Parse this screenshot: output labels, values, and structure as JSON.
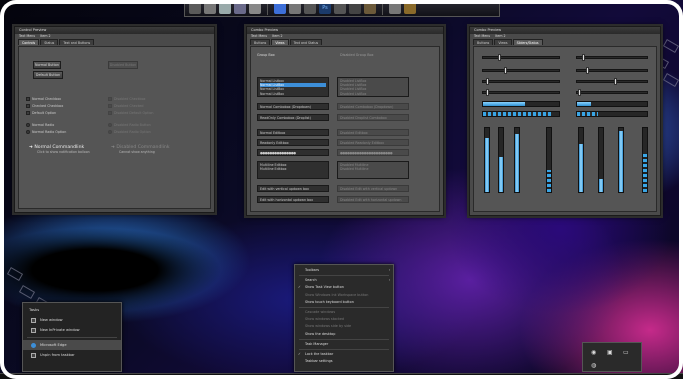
{
  "dock": {
    "icons": [
      "app-icon-1",
      "app-icon-2",
      "app-icon-3",
      "app-icon-4",
      "app-icon-5",
      "globe-icon",
      "app-icon-6",
      "app-icon-7",
      "photoshop-icon",
      "app-icon-8",
      "app-icon-9",
      "app-icon-10",
      "app-icon-11",
      "game-icon"
    ],
    "labels": {
      "ps": "Ps"
    }
  },
  "window1": {
    "title": "Control Preview",
    "menu": [
      "Text Menu",
      "Item 2"
    ],
    "tabs": [
      "Controls",
      "Status",
      "Text and Buttons"
    ],
    "normal_button": "Normal Button",
    "default_button": "Default Button",
    "disabled_button": "Disabled Button",
    "checkboxes_left": [
      "Normal Checkbox",
      "Checked Checkbox",
      "Default Option"
    ],
    "checkboxes_right": [
      "Disabled Checkbox",
      "Disabled Checked",
      "Disabled Default Option"
    ],
    "radios_left": [
      "Normal Radio",
      "Normal Radio Option"
    ],
    "radios_right": [
      "Disabled Radio Button",
      "Disabled Radio Option"
    ],
    "cmdlink_title": "Normal Commandlink",
    "cmdlink_sub": "Click to show notification balloon",
    "cmdlink_disabled_title": "Disabled Commandlink",
    "cmdlink_disabled_sub": "Cannot show anything"
  },
  "window2": {
    "title": "Combo Preview",
    "menu": [
      "Text Menu",
      "Item 2"
    ],
    "tabs": [
      "Buttons",
      "Views",
      "Text and Status"
    ],
    "group_left": "Group Box",
    "group_right": "Disabled Group Box",
    "list_items": [
      "Normal Listbox",
      "Normal ListBox",
      "Normal ListBox",
      "Normal ListBox"
    ],
    "list_disabled_items": [
      "Disabled ListBox",
      "Disabled ListBox",
      "Disabled ListBox",
      "Disabled ListBox"
    ],
    "combo_normal": "Normal Combobox (Dropdown)",
    "combo_disabled": "Disabled Combobox (Dropdown)",
    "combo_edit": "ReadOnly Combobox (Droplist)",
    "combo_edit_disabled": "Disabled Droplist Combobox",
    "edit_normal": "Normal Editbox",
    "edit_disabled": "Disabled Editbox",
    "edit_readonly": "Readonly Editbox",
    "edit_readonly_disabled": "Disabled Readonly Editbox",
    "password": "●●●●●●●●●●●●●●●",
    "password_disabled": "●●●●●●●●●●●●●●●●●●●●●●",
    "multiline": [
      "Multiline Editbox",
      "Multiline Editbox"
    ],
    "multiline_disabled": [
      "Disabled Multiline",
      "Disabled Multiline"
    ],
    "spin_vertical": "Edit with vertical updown box",
    "spin_vertical_disabled": "Disabled Edit with vertical updown",
    "spin_horizontal": "Edit with horizontal updown box",
    "spin_horizontal_disabled": "Disabled Edit with horizontal updown"
  },
  "window3": {
    "title": "Combo Preview",
    "menu": [
      "Text Menu",
      "Item 2"
    ],
    "tabs": [
      "Buttons",
      "Views",
      "Sliders/Status"
    ],
    "h_progress": [
      0.55,
      0.2,
      0.9,
      0.3
    ],
    "v_progress": [
      0.85,
      0.55,
      0.9,
      0.35,
      0.75,
      0.2,
      0.95,
      0.6
    ]
  },
  "context_menu": {
    "items": [
      {
        "label": "Toolbars",
        "arrow": "›",
        "disabled": false,
        "check": ""
      },
      {
        "sep": true
      },
      {
        "label": "Search",
        "arrow": "›",
        "disabled": false,
        "check": ""
      },
      {
        "label": "Show Task View button",
        "arrow": "",
        "disabled": false,
        "check": "✓"
      },
      {
        "label": "Show Windows Ink Workspace button",
        "arrow": "",
        "disabled": true,
        "check": ""
      },
      {
        "label": "Show touch keyboard button",
        "arrow": "",
        "disabled": false,
        "check": ""
      },
      {
        "sep": true
      },
      {
        "label": "Cascade windows",
        "arrow": "",
        "disabled": true,
        "check": ""
      },
      {
        "label": "Show windows stacked",
        "arrow": "",
        "disabled": true,
        "check": ""
      },
      {
        "label": "Show windows side by side",
        "arrow": "",
        "disabled": true,
        "check": ""
      },
      {
        "label": "Show the desktop",
        "arrow": "",
        "disabled": false,
        "check": ""
      },
      {
        "sep": true
      },
      {
        "label": "Task Manager",
        "arrow": "",
        "disabled": false,
        "check": ""
      },
      {
        "sep": true
      },
      {
        "label": "Lock the taskbar",
        "arrow": "",
        "disabled": false,
        "check": "✓"
      },
      {
        "label": "Taskbar settings",
        "arrow": "",
        "disabled": false,
        "check": ""
      }
    ]
  },
  "jump_list": {
    "header": "Tasks",
    "items": [
      "New window",
      "New InPrivate window",
      "Microsoft Edge",
      "Unpin from taskbar"
    ]
  },
  "colors": {
    "accent": "#3d8fd8",
    "progress": "#6cc6ff"
  }
}
